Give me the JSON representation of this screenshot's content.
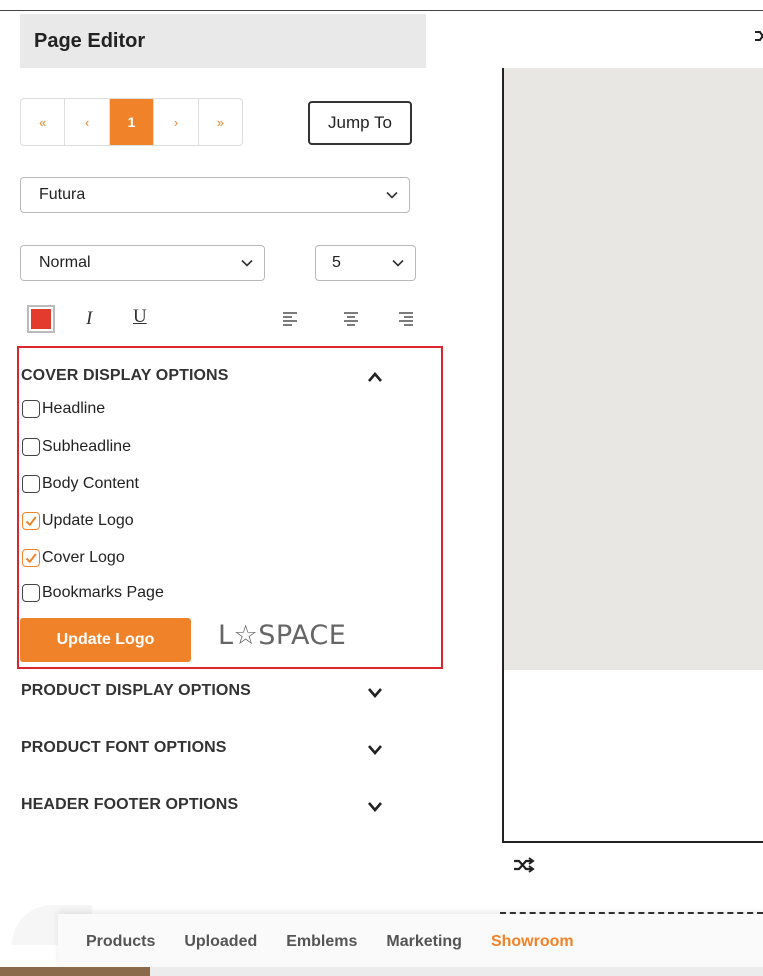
{
  "header": {
    "title": "Page Editor"
  },
  "pagination": {
    "first": "«",
    "prev": "‹",
    "current": "1",
    "next": "›",
    "last": "»"
  },
  "jump_to": "Jump To",
  "font_family": {
    "selected": "Futura"
  },
  "font_style": {
    "selected": "Normal"
  },
  "font_size": {
    "selected": "5"
  },
  "toolbar": {
    "color": "#e33b2e",
    "italic": "I",
    "underline": "U",
    "align_icons": [
      "align-left-icon",
      "align-center-icon",
      "align-right-icon"
    ]
  },
  "cover_options": {
    "title": "COVER DISPLAY OPTIONS",
    "expanded": true,
    "items": [
      {
        "label": "Headline",
        "checked": false
      },
      {
        "label": "Subheadline",
        "checked": false
      },
      {
        "label": "Body Content",
        "checked": false
      },
      {
        "label": "Update Logo",
        "checked": true
      },
      {
        "label": "Cover Logo",
        "checked": true
      },
      {
        "label": "Bookmarks Page",
        "checked": false
      }
    ],
    "update_logo_button": "Update Logo",
    "logo_text": "L☆SPACE"
  },
  "sections": [
    {
      "title": "PRODUCT DISPLAY OPTIONS",
      "expanded": false
    },
    {
      "title": "PRODUCT FONT OPTIONS",
      "expanded": false
    },
    {
      "title": "HEADER FOOTER OPTIONS",
      "expanded": false
    }
  ],
  "bottom_tabs": {
    "items": [
      "Products",
      "Uploaded",
      "Emblems",
      "Marketing",
      "Showroom"
    ],
    "active": "Showroom"
  },
  "colors": {
    "accent": "#f0832a",
    "highlight_border": "#d9262f"
  }
}
